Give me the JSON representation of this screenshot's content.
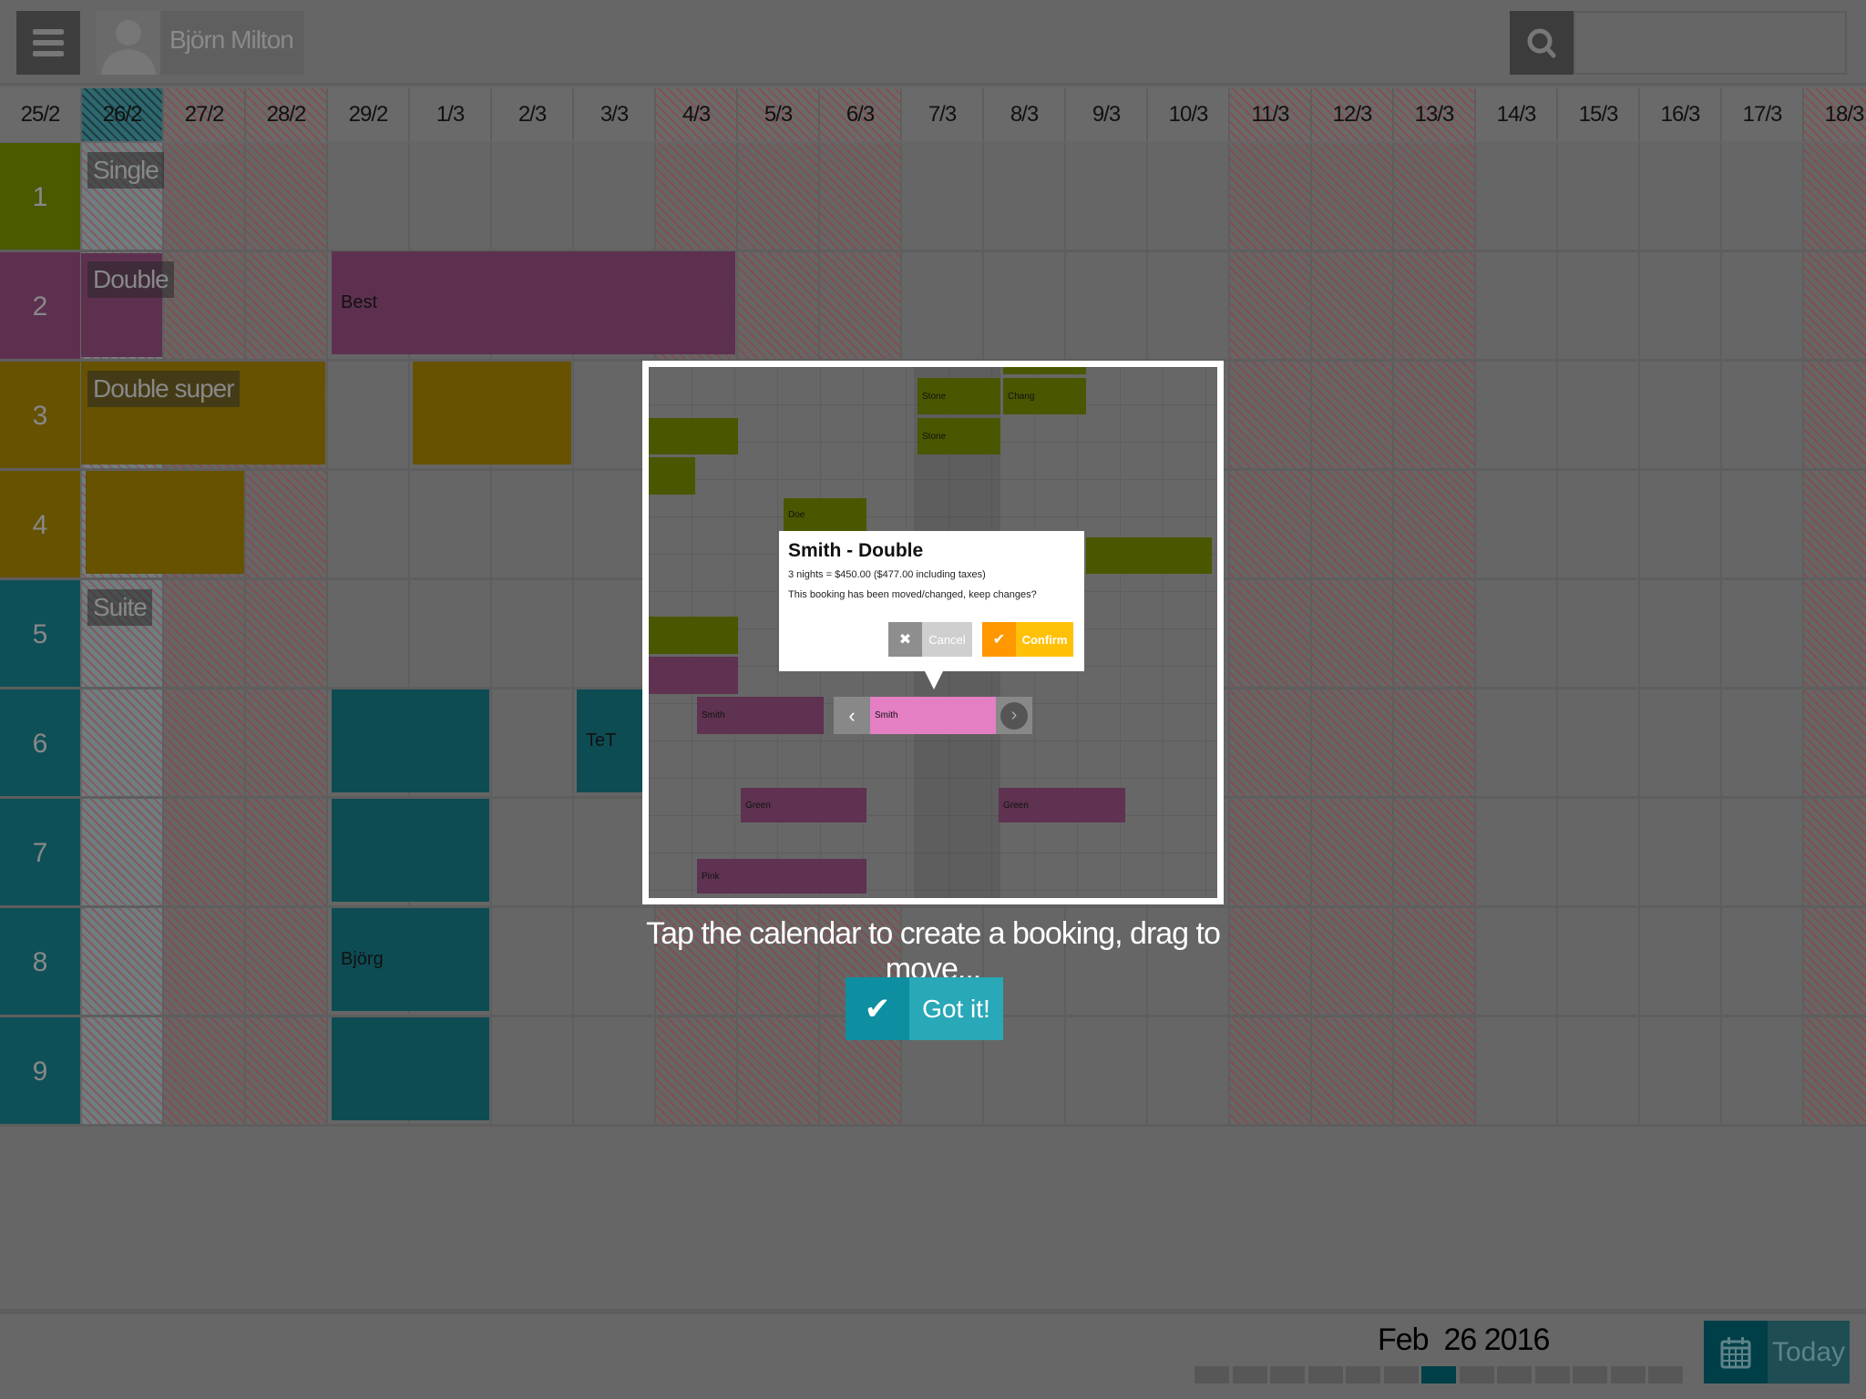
{
  "header": {
    "user_name": "Björn Milton",
    "search_placeholder": ""
  },
  "dates": [
    {
      "label": "25/2",
      "hatch": false
    },
    {
      "label": "26/2",
      "hatch": "today"
    },
    {
      "label": "27/2",
      "hatch": true
    },
    {
      "label": "28/2",
      "hatch": true
    },
    {
      "label": "29/2",
      "hatch": false
    },
    {
      "label": "1/3",
      "hatch": false
    },
    {
      "label": "2/3",
      "hatch": false
    },
    {
      "label": "3/3",
      "hatch": false
    },
    {
      "label": "4/3",
      "hatch": true
    },
    {
      "label": "5/3",
      "hatch": true
    },
    {
      "label": "6/3",
      "hatch": true
    },
    {
      "label": "7/3",
      "hatch": false
    },
    {
      "label": "8/3",
      "hatch": false
    },
    {
      "label": "9/3",
      "hatch": false
    },
    {
      "label": "10/3",
      "hatch": false
    },
    {
      "label": "11/3",
      "hatch": true
    },
    {
      "label": "12/3",
      "hatch": true
    },
    {
      "label": "13/3",
      "hatch": true
    },
    {
      "label": "14/3",
      "hatch": false
    },
    {
      "label": "15/3",
      "hatch": false
    },
    {
      "label": "16/3",
      "hatch": false
    },
    {
      "label": "17/3",
      "hatch": false
    },
    {
      "label": "18/3",
      "hatch": true
    }
  ],
  "rooms": [
    {
      "number": "1",
      "type": "Single",
      "color": "#4b5a00"
    },
    {
      "number": "2",
      "type": "Double",
      "color": "#5e3050"
    },
    {
      "number": "3",
      "type": "Double super",
      "color": "#665200"
    },
    {
      "number": "4",
      "type": "",
      "color": "#665200"
    },
    {
      "number": "5",
      "type": "Suite",
      "color": "#0e5058"
    },
    {
      "number": "6",
      "type": "",
      "color": "#0e5058"
    },
    {
      "number": "7",
      "type": "",
      "color": "#0e5058"
    },
    {
      "number": "8",
      "type": "",
      "color": "#0e5058"
    },
    {
      "number": "9",
      "type": "",
      "color": "#0e5058"
    }
  ],
  "bookings": {
    "best": "Best",
    "tet": "TeT",
    "bjorg": "Björg"
  },
  "tutorial": {
    "stone": "Stone",
    "chang": "Chang",
    "stone2": "Stone",
    "doe": "Doe",
    "smith": "Smith",
    "smith_drag": "Smith",
    "green1": "Green",
    "green2": "Green",
    "pink": "Pink",
    "popup": {
      "title": "Smith - Double",
      "line1": "3 nights = $450.00 ($477.00 including taxes)",
      "line2": "This booking has been moved/changed, keep changes?",
      "cancel": "Cancel",
      "confirm": "Confirm"
    },
    "caption": "Tap the calendar to create a booking, drag to move...",
    "got_it": "Got it!"
  },
  "footer": {
    "date": "Feb  26 2016",
    "today": "Today",
    "week_markers": 13,
    "active_marker": 7
  }
}
